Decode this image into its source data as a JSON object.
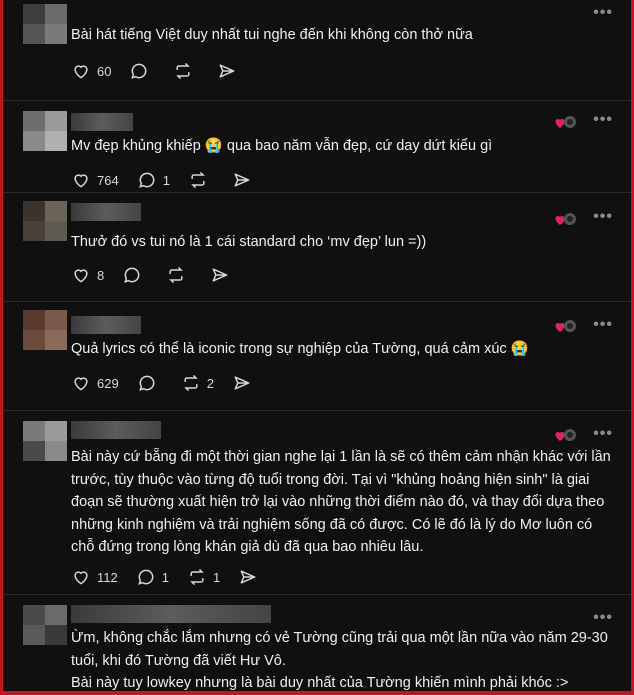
{
  "posts": [
    {
      "text": "Bài hát tiếng Việt duy nhất tui nghe đến khi không còn thở nữa",
      "likes": "60",
      "replies": "",
      "reposts": ""
    },
    {
      "text": "Mv đẹp khủng khiếp 😭 qua bao năm vẫn đẹp, cứ day dứt kiểu gì",
      "likes": "764",
      "replies": "1",
      "reposts": ""
    },
    {
      "text": "Thưở đó vs tui nó là 1 cái standard cho ‘mv đẹp’ lun =))",
      "likes": "8",
      "replies": "",
      "reposts": ""
    },
    {
      "text": "Quả lyrics có thể là iconic trong sự nghiệp của Tường, quá cảm xúc 😭",
      "likes": "629",
      "replies": "",
      "reposts": "2"
    },
    {
      "text": "Bài này cứ bẵng đi một thời gian nghe lại 1 lần là sẽ có thêm cảm nhận khác với lần trước, tùy thuộc vào từng độ tuổi trong đời. Tại vì \"khủng hoảng hiện sinh\" là giai đoạn sẽ thường xuất hiện trở lại vào những thời điểm nào đó, và thay đổi dựa theo những kinh nghiệm và trải nghiệm sống đã có được. Có lẽ đó là lý do Mơ luôn có chỗ đứng trong lòng khán giả dù đã qua bao nhiêu lâu.",
      "likes": "112",
      "replies": "1",
      "reposts": "1"
    },
    {
      "text": "Ừm, không chắc lắm nhưng có vẻ Tường cũng trải qua một lần nữa vào năm 29-30 tuổi, khi đó Tường đã viết Hư Vô.\nBài này tuy lowkey nhưng là bài duy nhất của Tường khiến mình phải khóc :>",
      "likes": "",
      "replies": "",
      "reposts": ""
    }
  ],
  "more_label": "•••",
  "colors": {
    "background": "#101010",
    "text": "#f0f0f0",
    "border": "#c4161c"
  }
}
